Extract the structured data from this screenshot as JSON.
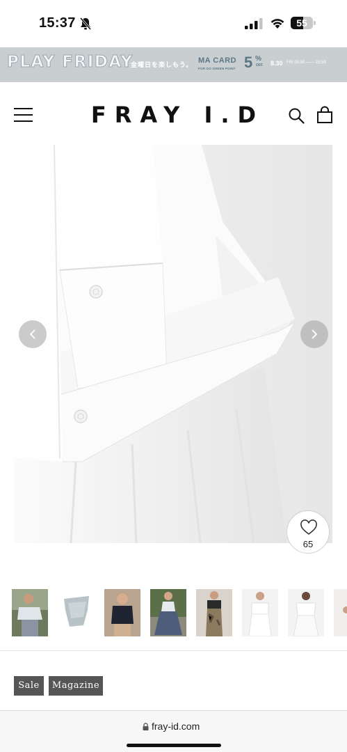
{
  "status_bar": {
    "time": "15:37",
    "battery_level": "55",
    "battery_fraction": 0.55
  },
  "promo": {
    "title": "PLAY FRIDAY",
    "tagline": "金曜日を楽しもう。",
    "card_name": "MA CARD",
    "card_sub": "FOR GO GREEN POINT",
    "percent_number": "5",
    "percent_sign": "%",
    "percent_off": "OFF",
    "date": "8.30",
    "time_range": "FRI 00:00 —— 23:59"
  },
  "header": {
    "logo": "FRAY I.D"
  },
  "product": {
    "favorite_count": "65"
  },
  "thumbnails": [
    {
      "name": "thumb-1"
    },
    {
      "name": "thumb-2"
    },
    {
      "name": "thumb-3"
    },
    {
      "name": "thumb-4"
    },
    {
      "name": "thumb-5"
    },
    {
      "name": "thumb-6"
    },
    {
      "name": "thumb-7"
    },
    {
      "name": "thumb-8"
    }
  ],
  "tags": {
    "sale": "Sale",
    "magazine": "Magazine"
  },
  "browser": {
    "url": "fray-id.com"
  },
  "colors": {
    "banner_bg": "#c9ced1",
    "banner_accent": "#5b7784",
    "tag_bg": "#555555"
  }
}
